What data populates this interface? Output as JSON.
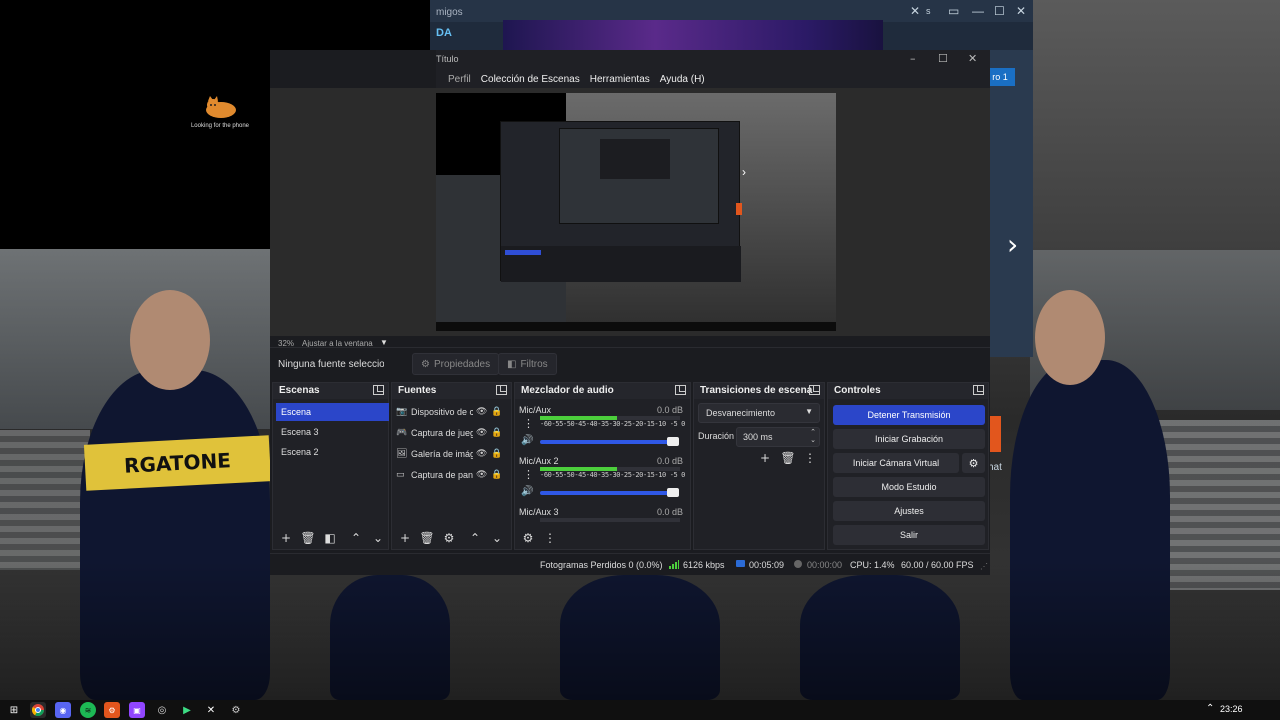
{
  "desktop": {
    "cat_caption": "Looking for the phone",
    "jersey_text": "RGATONE"
  },
  "background_window": {
    "tab_text": "migos",
    "logo_text": "DA",
    "badge_text": "ro 1",
    "chat_label": "hat",
    "tab_extra": "s"
  },
  "obs": {
    "window_title": "Título",
    "menu": [
      "Perfil",
      "Colección de Escenas",
      "Herramientas",
      "Ayuda (H)"
    ],
    "zoom_value": "32%",
    "fit_label": "Ajustar a la ventana",
    "no_source_label": "Ninguna fuente seleccionada",
    "properties_label": "Propiedades",
    "filters_label": "Filtros",
    "docks": {
      "scenes": {
        "title": "Escenas",
        "items": [
          {
            "label": "Escena",
            "active": true
          },
          {
            "label": "Escena 3",
            "active": false
          },
          {
            "label": "Escena 2",
            "active": false
          }
        ]
      },
      "sources": {
        "title": "Fuentes",
        "items": [
          {
            "label": "Dispositivo de captura de video",
            "icon": "camera-icon"
          },
          {
            "label": "Captura de juego",
            "icon": "gamepad-icon"
          },
          {
            "label": "Galería de imágenes",
            "icon": "image-gallery-icon"
          },
          {
            "label": "Captura de pantalla",
            "icon": "monitor-icon"
          }
        ]
      },
      "mixer": {
        "title": "Mezclador de audio",
        "scale": "-60-55-50-45-40-35-30-25-20-15-10 -5  0",
        "tracks": [
          {
            "name": "Mic/Aux",
            "db": "0.0 dB",
            "level": 0.55,
            "volume": 1.0
          },
          {
            "name": "Mic/Aux 2",
            "db": "0.0 dB",
            "level": 0.55,
            "volume": 1.0
          },
          {
            "name": "Mic/Aux 3",
            "db": "0.0 dB",
            "level": 0.0,
            "volume": 1.0
          }
        ]
      },
      "transitions": {
        "title": "Transiciones de escena",
        "selected": "Desvanecimiento",
        "duration_label": "Duración",
        "duration_value": "300 ms"
      },
      "controls": {
        "title": "Controles",
        "buttons": [
          "Detener Transmisión",
          "Iniciar Grabación",
          "Iniciar Cámara Virtual",
          "Modo Estudio",
          "Ajustes",
          "Salir"
        ]
      }
    },
    "status": {
      "dropped_frames": "Fotogramas Perdidos 0 (0.0%)",
      "bitrate": "6126 kbps",
      "stream_time": "00:05:09",
      "rec_time": "00:00:00",
      "cpu": "CPU: 1.4%",
      "fps": "60.00 / 60.00 FPS"
    }
  },
  "taskbar": {
    "clock": "23:26",
    "icons": [
      "windows-start-icon",
      "chrome-icon",
      "discord-icon",
      "spotify-icon",
      "steam-icon",
      "twitch-icon",
      "obs-icon",
      "gamebar-icon",
      "xbox-icon",
      "settings-app-icon"
    ]
  },
  "colors": {
    "accent": "#2b46c9",
    "meter_green": "#4ccf3c",
    "obs_bg": "#1b1c20",
    "steam_blue": "#1a6fc4"
  }
}
